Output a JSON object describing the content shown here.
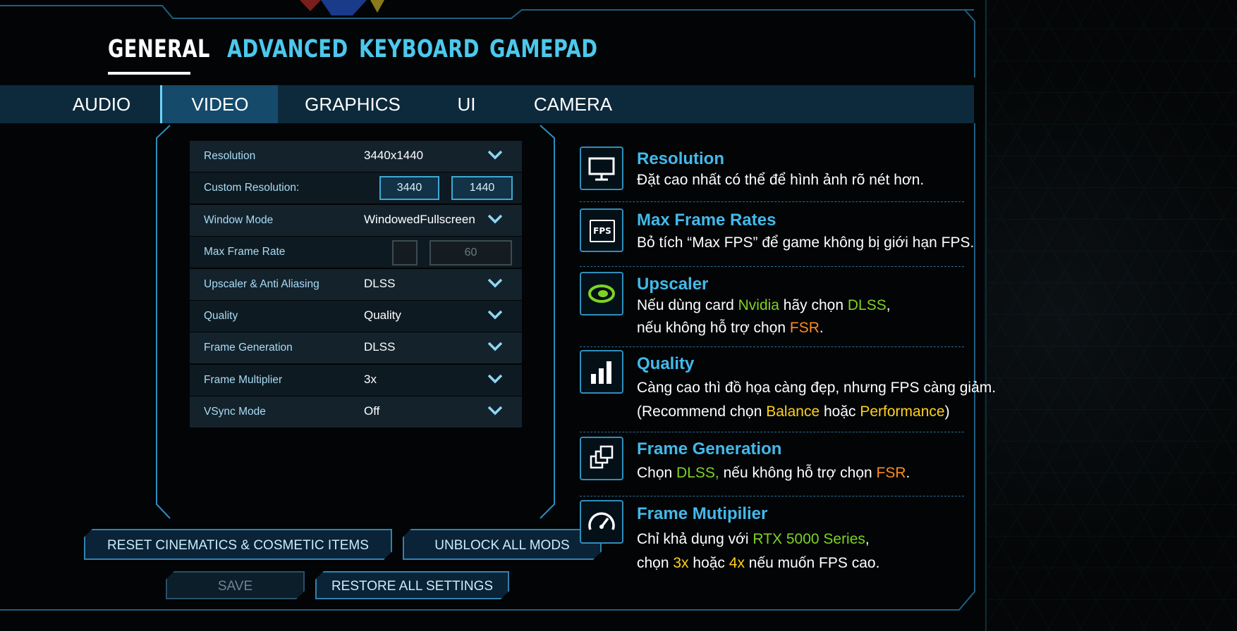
{
  "top_tabs": [
    {
      "label": "GENERAL",
      "active": true
    },
    {
      "label": "ADVANCED",
      "active": false
    },
    {
      "label": "KEYBOARD",
      "active": false
    },
    {
      "label": "GAMEPAD",
      "active": false
    }
  ],
  "sub_tabs": [
    {
      "label": "AUDIO",
      "active": false
    },
    {
      "label": "VIDEO",
      "active": true
    },
    {
      "label": "GRAPHICS",
      "active": false
    },
    {
      "label": "UI",
      "active": false
    },
    {
      "label": "CAMERA",
      "active": false
    }
  ],
  "settings": {
    "resolution": {
      "label": "Resolution",
      "value": "3440x1440"
    },
    "custom_resolution": {
      "label": "Custom Resolution:",
      "width": "3440",
      "height": "1440"
    },
    "window_mode": {
      "label": "Window Mode",
      "value": "WindowedFullscreen"
    },
    "max_frame_rate": {
      "label": "Max Frame Rate",
      "value": "60",
      "checked": false
    },
    "upscaler": {
      "label": "Upscaler & Anti Aliasing",
      "value": "DLSS"
    },
    "quality": {
      "label": "Quality",
      "value": "Quality"
    },
    "frame_generation": {
      "label": "Frame Generation",
      "value": "DLSS"
    },
    "frame_multiplier": {
      "label": "Frame Multiplier",
      "value": "3x"
    },
    "vsync": {
      "label": "VSync Mode",
      "value": "Off"
    }
  },
  "buttons": {
    "reset_cinematics": "RESET CINEMATICS & COSMETIC ITEMS",
    "unblock_mods": "UNBLOCK ALL MODS",
    "save": "SAVE",
    "restore": "RESTORE ALL SETTINGS"
  },
  "info": {
    "resolution": {
      "icon": "monitor-icon",
      "title": "Resolution",
      "text": "Đặt cao nhất có thể để hình ảnh rõ nét hơn."
    },
    "max_frame_rates": {
      "icon": "fps-icon",
      "icon_text": "FPS",
      "title": "Max Frame Rates",
      "text": "Bỏ tích “Max FPS” để game không bị giới hạn FPS."
    },
    "upscaler": {
      "icon": "nvidia-icon",
      "title": "Upscaler",
      "line1_a": "Nếu dùng card ",
      "line1_b": "Nvidia",
      "line1_c": " hãy chọn ",
      "line1_d": "DLSS",
      "line1_e": ",",
      "line2_a": "nếu không hỗ trợ chọn ",
      "line2_b": "FSR",
      "line2_c": "."
    },
    "quality": {
      "icon": "bar-chart-icon",
      "title": "Quality",
      "line1": "Càng cao thì đồ họa càng đẹp, nhưng FPS càng giảm.",
      "line2_a": "(Recommend chọn ",
      "line2_b": "Balance",
      "line2_c": " hoặc ",
      "line2_d": "Performance",
      "line2_e": ")"
    },
    "frame_generation": {
      "icon": "stacked-frames-icon",
      "title": "Frame Generation",
      "line_a": "Chọn ",
      "line_b": "DLSS,",
      "line_c": " nếu không hỗ trợ chọn ",
      "line_d": "FSR",
      "line_e": "."
    },
    "frame_multiplier": {
      "icon": "gauge-icon",
      "title": "Frame Mutipilier",
      "line1_a": "Chỉ khả dụng với ",
      "line1_b": "RTX 5000 Series",
      "line1_c": ",",
      "line2_a": "chọn ",
      "line2_b": "3x",
      "line2_c": " hoặc ",
      "line2_d": "4x",
      "line2_e": " nếu muốn FPS cao."
    }
  },
  "colors": {
    "accent": "#43b9ea",
    "nvidia_green": "#7ed321",
    "fsr_orange": "#ff8c1a",
    "highlight_yellow": "#ffd21a",
    "subbar": "#0d2a3c"
  }
}
